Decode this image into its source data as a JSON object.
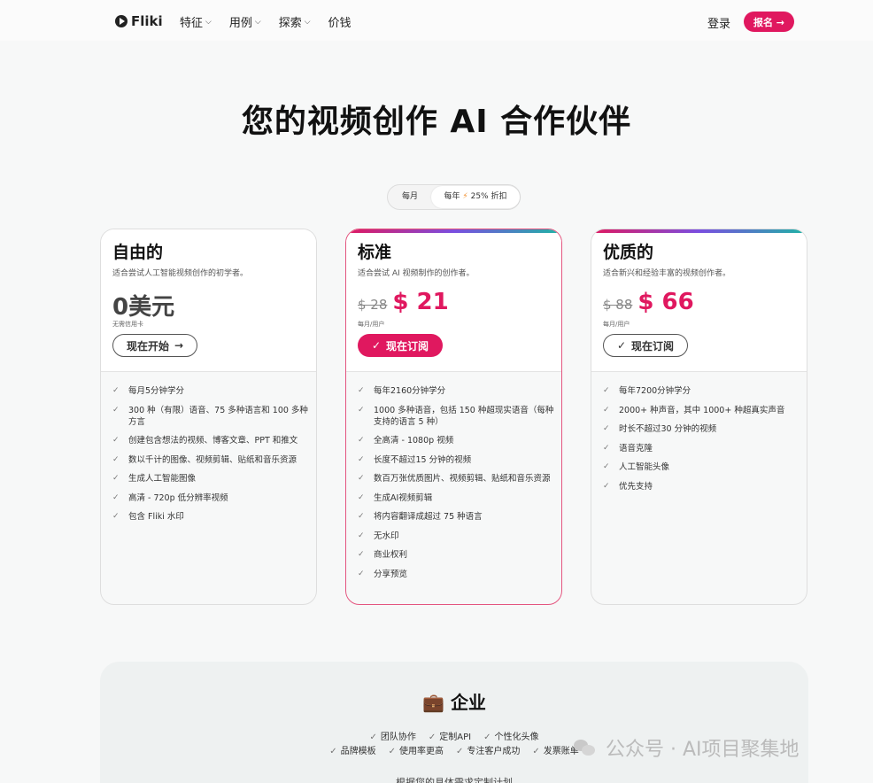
{
  "nav": {
    "logo": "Fliki",
    "menu": [
      "特征",
      "用例",
      "探索",
      "价钱"
    ],
    "login": "登录",
    "signup": "报名 →"
  },
  "hero": {
    "title": "您的视频创作 AI 合作伙伴"
  },
  "billing_toggle": {
    "monthly": "每月",
    "yearly_prefix": "每年",
    "yearly_discount": "25% 折扣",
    "selected": "yearly"
  },
  "plans": [
    {
      "name": "自由的",
      "desc": "适合尝试人工智能视频创作的初学者。",
      "old_price": "",
      "price": "0美元",
      "unit": "无需信用卡",
      "cta": "现在开始",
      "features": [
        "每月5分钟学分",
        "300 种（有限）语音、75 多种语言和 100 多种方言",
        "创建包含想法的视频、博客文章、PPT 和推文",
        "数以千计的图像、视频剪辑、贴纸和音乐资源",
        "生成人工智能图像",
        "高清 - 720p 低分辨率视频",
        "包含 Fliki 水印"
      ]
    },
    {
      "name": "标准",
      "desc": "适合尝试 AI 视频制作的创作者。",
      "old_price": "$ 28",
      "price": "$ 21",
      "unit": "每月/用户",
      "cta": "现在订阅",
      "features": [
        "每年2160分钟学分",
        "1000 多种语音，包括 150 种超现实语音（每种支持的语言 5 种）",
        "全高清 - 1080p 视频",
        "长度不超过15 分钟的视频",
        "数百万张优质图片、视频剪辑、贴纸和音乐资源",
        "生成AI视频剪辑",
        "将内容翻译成超过 75 种语言",
        "无水印",
        "商业权利",
        "分享预览"
      ]
    },
    {
      "name": "优质的",
      "desc": "适合新兴和经验丰富的视频创作者。",
      "old_price": "$ 88",
      "price": "$ 66",
      "unit": "每月/用户",
      "cta": "现在订阅",
      "features": [
        "每年7200分钟学分",
        "2000+ 种声音，其中 1000+ 种超真实声音",
        "时长不超过30 分钟的视频",
        "语音克隆",
        "人工智能头像",
        "优先支持"
      ]
    }
  ],
  "enterprise": {
    "icon": "💼",
    "title": "企业",
    "row1": [
      "团队协作",
      "定制API",
      "个性化头像"
    ],
    "row2": [
      "品牌模板",
      "使用率更高",
      "专注客户成功",
      "发票账单"
    ],
    "tail": "根据您的具体需求定制计划"
  },
  "watermark": {
    "text": "公众号 · AI项目聚集地"
  },
  "colors": {
    "accent": "#e0185f",
    "card_border_featured": "#e4557f"
  }
}
